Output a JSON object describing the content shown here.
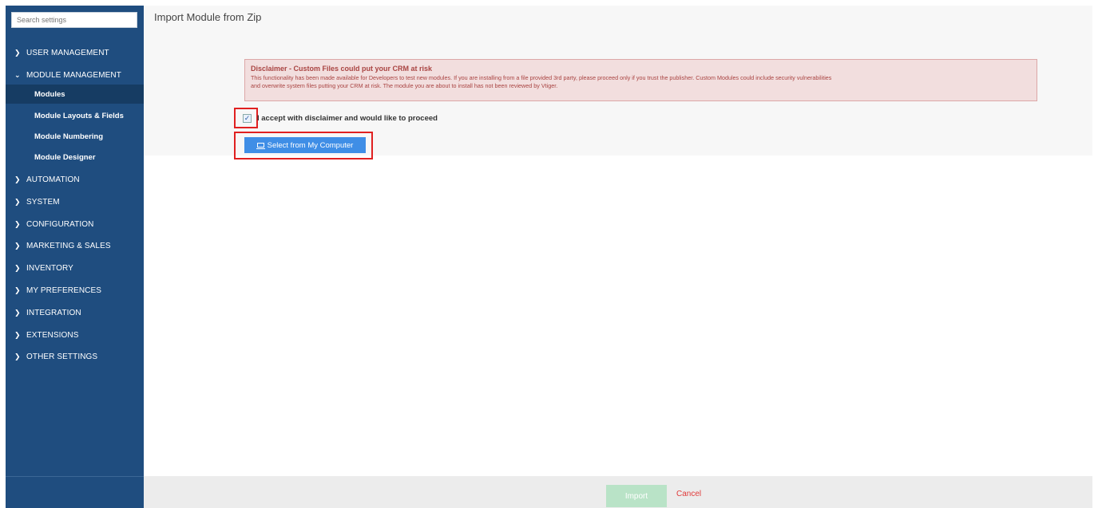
{
  "sidebar": {
    "search_placeholder": "Search settings",
    "items": [
      {
        "label": "USER MANAGEMENT",
        "chevron": "chevron-right-icon"
      },
      {
        "label": "MODULE MANAGEMENT",
        "chevron": "chevron-down-icon"
      },
      {
        "label": "AUTOMATION",
        "chevron": "chevron-right-icon"
      },
      {
        "label": "SYSTEM",
        "chevron": "chevron-right-icon"
      },
      {
        "label": "CONFIGURATION",
        "chevron": "chevron-right-icon"
      },
      {
        "label": "MARKETING & SALES",
        "chevron": "chevron-right-icon"
      },
      {
        "label": "INVENTORY",
        "chevron": "chevron-right-icon"
      },
      {
        "label": "MY PREFERENCES",
        "chevron": "chevron-right-icon"
      },
      {
        "label": "INTEGRATION",
        "chevron": "chevron-right-icon"
      },
      {
        "label": "EXTENSIONS",
        "chevron": "chevron-right-icon"
      },
      {
        "label": "OTHER SETTINGS",
        "chevron": "chevron-right-icon"
      }
    ],
    "sub_items": [
      {
        "label": "Modules",
        "active": true
      },
      {
        "label": "Module Layouts & Fields",
        "active": false
      },
      {
        "label": "Module Numbering",
        "active": false
      },
      {
        "label": "Module Designer",
        "active": false
      }
    ]
  },
  "main": {
    "title": "Import Module from Zip",
    "disclaimer": {
      "title": "Disclaimer - Custom Files could put your CRM at risk",
      "body_line1": "This functionality has been made available for Developers to test new modules. If you are installing from a file provided 3rd party, please proceed only if you trust the publisher. Custom Modules could include security vulnerabilities",
      "body_line2": "and overwrite system files putting your CRM at risk. The module you are about to install has not been reviewed by Vtiger."
    },
    "accept_label": "I accept with disclaimer and would like to proceed",
    "accept_checked": true,
    "select_button_label": "Select from My Computer"
  },
  "footer": {
    "import_label": "Import",
    "cancel_label": "Cancel"
  },
  "colors": {
    "sidebar_bg": "#1f4d7f",
    "active_item_bg": "#163c63",
    "disclaimer_bg": "#f2dede",
    "disclaimer_text": "#a94442",
    "primary_button": "#3f8ee6",
    "import_button": "#b9e3c7",
    "cancel_text": "#e03a3a",
    "highlight": "#e02020"
  }
}
